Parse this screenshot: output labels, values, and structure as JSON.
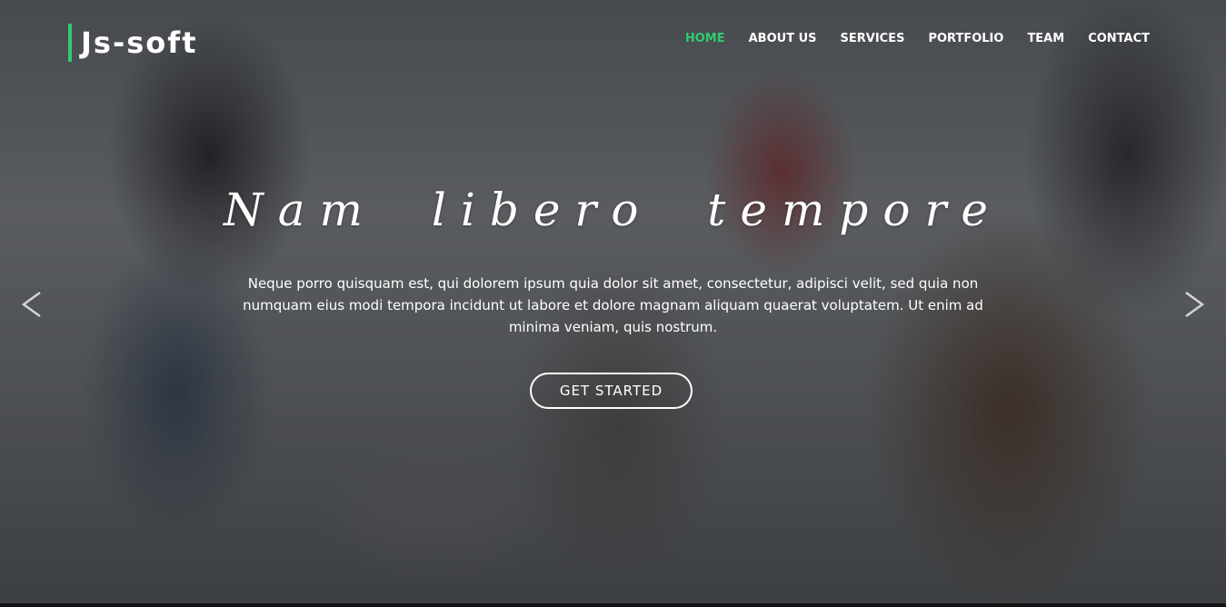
{
  "brand": {
    "name": "Js-soft",
    "accent_color": "#2ecc71"
  },
  "nav": {
    "items": [
      {
        "label": "HOME",
        "active": true
      },
      {
        "label": "ABOUT US",
        "active": false
      },
      {
        "label": "SERVICES",
        "active": false
      },
      {
        "label": "PORTFOLIO",
        "active": false
      },
      {
        "label": "TEAM",
        "active": false
      },
      {
        "label": "CONTACT",
        "active": false
      }
    ]
  },
  "hero": {
    "headline": "Nam libero tempore",
    "description": "Neque porro quisquam est, qui dolorem ipsum quia dolor sit amet, consectetur, adipisci velit, sed quia non numquam eius modi tempora incidunt ut labore et dolore magnam aliquam quaerat voluptatem. Ut enim ad minima veniam, quis nostrum.",
    "cta_label": "GET STARTED",
    "prev_icon": "chevron-left-icon",
    "next_icon": "chevron-right-icon"
  }
}
